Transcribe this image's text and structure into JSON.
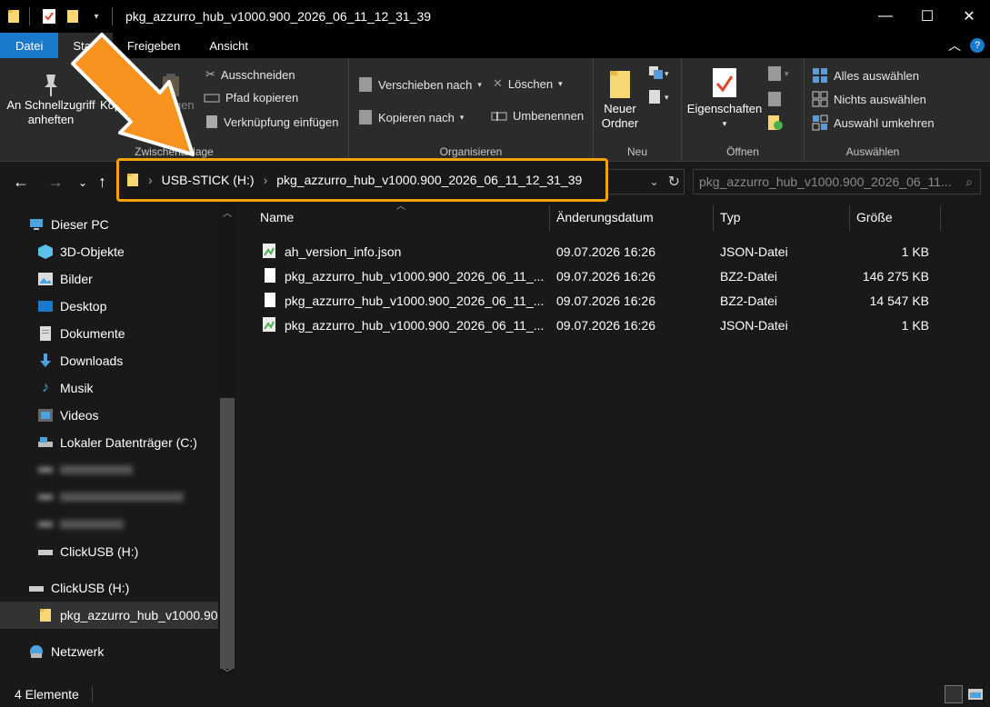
{
  "window": {
    "title": "pkg_azzurro_hub_v1000.900_2026_06_11_12_31_39",
    "minimize": "—",
    "maximize": "☐",
    "close": "✕"
  },
  "ribbon_tabs": [
    "Datei",
    "Start",
    "Freigeben",
    "Ansicht"
  ],
  "ribbon": {
    "pin_label_1": "An Schnellzugriff",
    "pin_label_2": "anheften",
    "copy_label": "Kopieren",
    "paste_label": "Einfügen",
    "cut_label": "Ausschneiden",
    "copy_path_label": "Pfad kopieren",
    "paste_shortcut_label": "Verknüpfung einfügen",
    "group_clipboard": "Zwischenablage",
    "move_to_label": "Verschieben nach",
    "copy_to_label": "Kopieren nach",
    "delete_label": "Löschen",
    "rename_label": "Umbenennen",
    "group_organize": "Organisieren",
    "new_folder_label_1": "Neuer",
    "new_folder_label_2": "Ordner",
    "group_new": "Neu",
    "properties_label": "Eigenschaften",
    "group_open": "Öffnen",
    "select_all_label": "Alles auswählen",
    "select_none_label": "Nichts auswählen",
    "invert_selection_label": "Auswahl umkehren",
    "group_select": "Auswählen"
  },
  "address": {
    "crumbs": [
      "USB-STICK (H:)",
      "pkg_azzurro_hub_v1000.900_2026_06_11_12_31_39"
    ],
    "search_placeholder": "pkg_azzurro_hub_v1000.900_2026_06_11..."
  },
  "sidebar": {
    "items": [
      {
        "label": "Dieser PC",
        "icon": "computer-icon"
      },
      {
        "label": "3D-Objekte",
        "icon": "cube-icon"
      },
      {
        "label": "Bilder",
        "icon": "pictures-icon"
      },
      {
        "label": "Desktop",
        "icon": "desktop-icon"
      },
      {
        "label": "Dokumente",
        "icon": "documents-icon"
      },
      {
        "label": "Downloads",
        "icon": "download-icon"
      },
      {
        "label": "Musik",
        "icon": "music-icon"
      },
      {
        "label": "Videos",
        "icon": "video-icon"
      },
      {
        "label": "Lokaler Datenträger (C:)",
        "icon": "drive-icon"
      },
      {
        "label": "ClickUSB (H:)",
        "icon": "usb-drive-icon"
      },
      {
        "label": "ClickUSB (H:)",
        "icon": "usb-drive-icon"
      },
      {
        "label": "pkg_azzurro_hub_v1000.90",
        "icon": "folder-icon"
      },
      {
        "label": "Netzwerk",
        "icon": "network-icon"
      }
    ]
  },
  "columns": [
    "Name",
    "Änderungsdatum",
    "Typ",
    "Größe"
  ],
  "files": [
    {
      "name": "ah_version_info.json",
      "date": "09.07.2026 16:26",
      "type": "JSON-Datei",
      "size": "1 KB"
    },
    {
      "name": "pkg_azzurro_hub_v1000.900_2026_06_11_...",
      "date": "09.07.2026 16:26",
      "type": "BZ2-Datei",
      "size": "146 275 KB"
    },
    {
      "name": "pkg_azzurro_hub_v1000.900_2026_06_11_...",
      "date": "09.07.2026 16:26",
      "type": "BZ2-Datei",
      "size": "14 547 KB"
    },
    {
      "name": "pkg_azzurro_hub_v1000.900_2026_06_11_...",
      "date": "09.07.2026 16:26",
      "type": "JSON-Datei",
      "size": "1 KB"
    }
  ],
  "status": {
    "count": "4 Elemente"
  },
  "colors": {
    "accent": "#1979ca",
    "highlight": "#f5a30b",
    "arrow": "#f7931e"
  }
}
